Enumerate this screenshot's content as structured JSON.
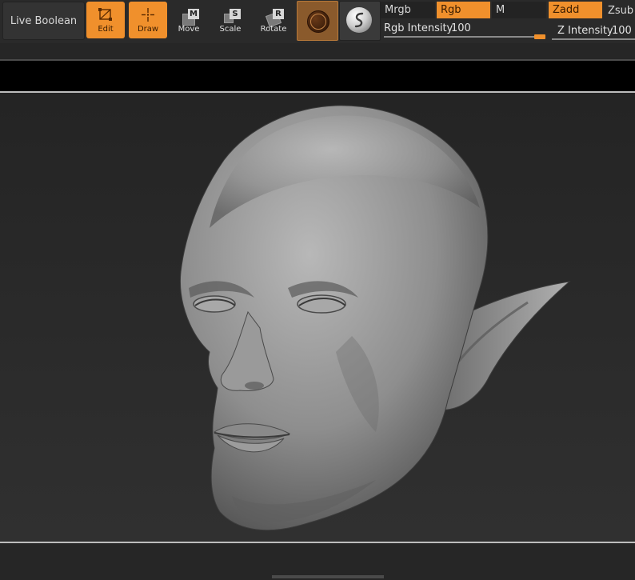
{
  "toolbar": {
    "live_boolean": "Live Boolean",
    "tools": [
      {
        "label": "Edit",
        "icon": "edit-icon",
        "active": true
      },
      {
        "label": "Draw",
        "icon": "draw-icon",
        "active": true
      },
      {
        "label": "Move",
        "icon": "move-icon",
        "key": "M",
        "active": false
      },
      {
        "label": "Scale",
        "icon": "scale-icon",
        "key": "S",
        "active": false
      },
      {
        "label": "Rotate",
        "icon": "rotate-icon",
        "key": "R",
        "active": false
      }
    ],
    "material_icon": "matcap-material-icon",
    "sphere_icon": "sphere-icon",
    "modes": {
      "mrgb": "Mrgb",
      "rgb": "Rgb",
      "m": "M",
      "zadd": "Zadd",
      "zsub": "Zsub"
    },
    "rgb_intensity": {
      "label": "Rgb Intensity",
      "value": "100"
    },
    "z_intensity": {
      "label": "Z Intensity",
      "value": "100"
    },
    "accent_color": "#f0902c"
  }
}
